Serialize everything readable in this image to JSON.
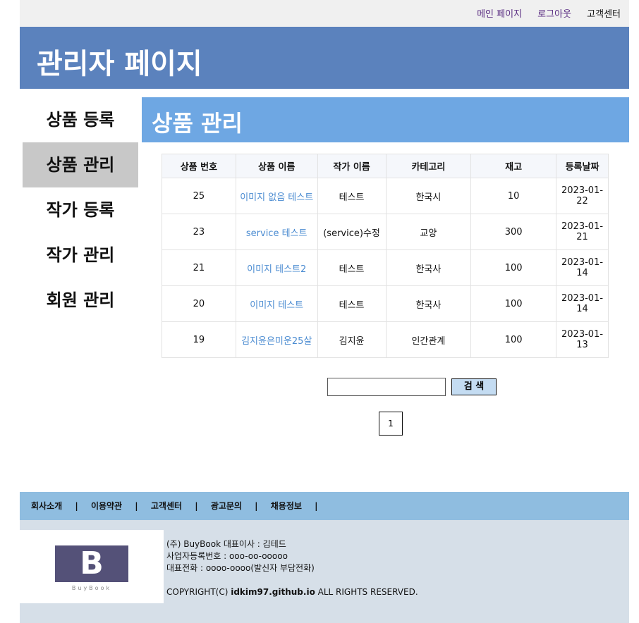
{
  "topbar": {
    "main": "메인 페이지",
    "logout": "로그아웃",
    "cs": "고객센터"
  },
  "header": {
    "title": "관리자 페이지"
  },
  "sidenav": [
    {
      "label": "상품 등록",
      "active": false
    },
    {
      "label": "상품 관리",
      "active": true
    },
    {
      "label": "작가 등록",
      "active": false
    },
    {
      "label": "작가 관리",
      "active": false
    },
    {
      "label": "회원 관리",
      "active": false
    }
  ],
  "content": {
    "title": "상품 관리"
  },
  "table": {
    "headers": [
      "상품 번호",
      "상품 이름",
      "작가 이름",
      "카테고리",
      "재고",
      "등록날짜"
    ],
    "rows": [
      [
        "25",
        "이미지 없음 테스트",
        "테스트",
        "한국시",
        "10",
        "2023-01-22"
      ],
      [
        "23",
        "service 테스트",
        "(service)수정",
        "교양",
        "300",
        "2023-01-21"
      ],
      [
        "21",
        "이미지 테스트2",
        "테스트",
        "한국사",
        "100",
        "2023-01-14"
      ],
      [
        "20",
        "이미지 테스트",
        "테스트",
        "한국사",
        "100",
        "2023-01-14"
      ],
      [
        "19",
        "김지윤은미운25살",
        "김지윤",
        "인간관계",
        "100",
        "2023-01-13"
      ]
    ]
  },
  "search": {
    "value": "",
    "button": "검 색"
  },
  "pager": {
    "page": "1"
  },
  "footer": {
    "nav": [
      "회사소개",
      "이용약관",
      "고객센터",
      "광고문의",
      "채용정보"
    ],
    "separator": "|",
    "logo_letter": "B",
    "logo_text": "BuyBook",
    "line1": "(주) BuyBook 대표이사 : 김테드",
    "line2": "사업자등록번호 : ooo-oo-ooooo",
    "line3": "대표전화 : oooo-oooo(발신자 부담전화)",
    "copyright_prefix": "COPYRIGHT(C) ",
    "copyright_site": "idkim97.github.io",
    "copyright_suffix": " ALL RIGHTS RESERVED."
  },
  "colors": {
    "header": "#5b82bd",
    "title": "#6ea7e3",
    "link": "#4a8bd1",
    "footer_nav": "#8fbde0",
    "footer": "#d6dfe8"
  }
}
